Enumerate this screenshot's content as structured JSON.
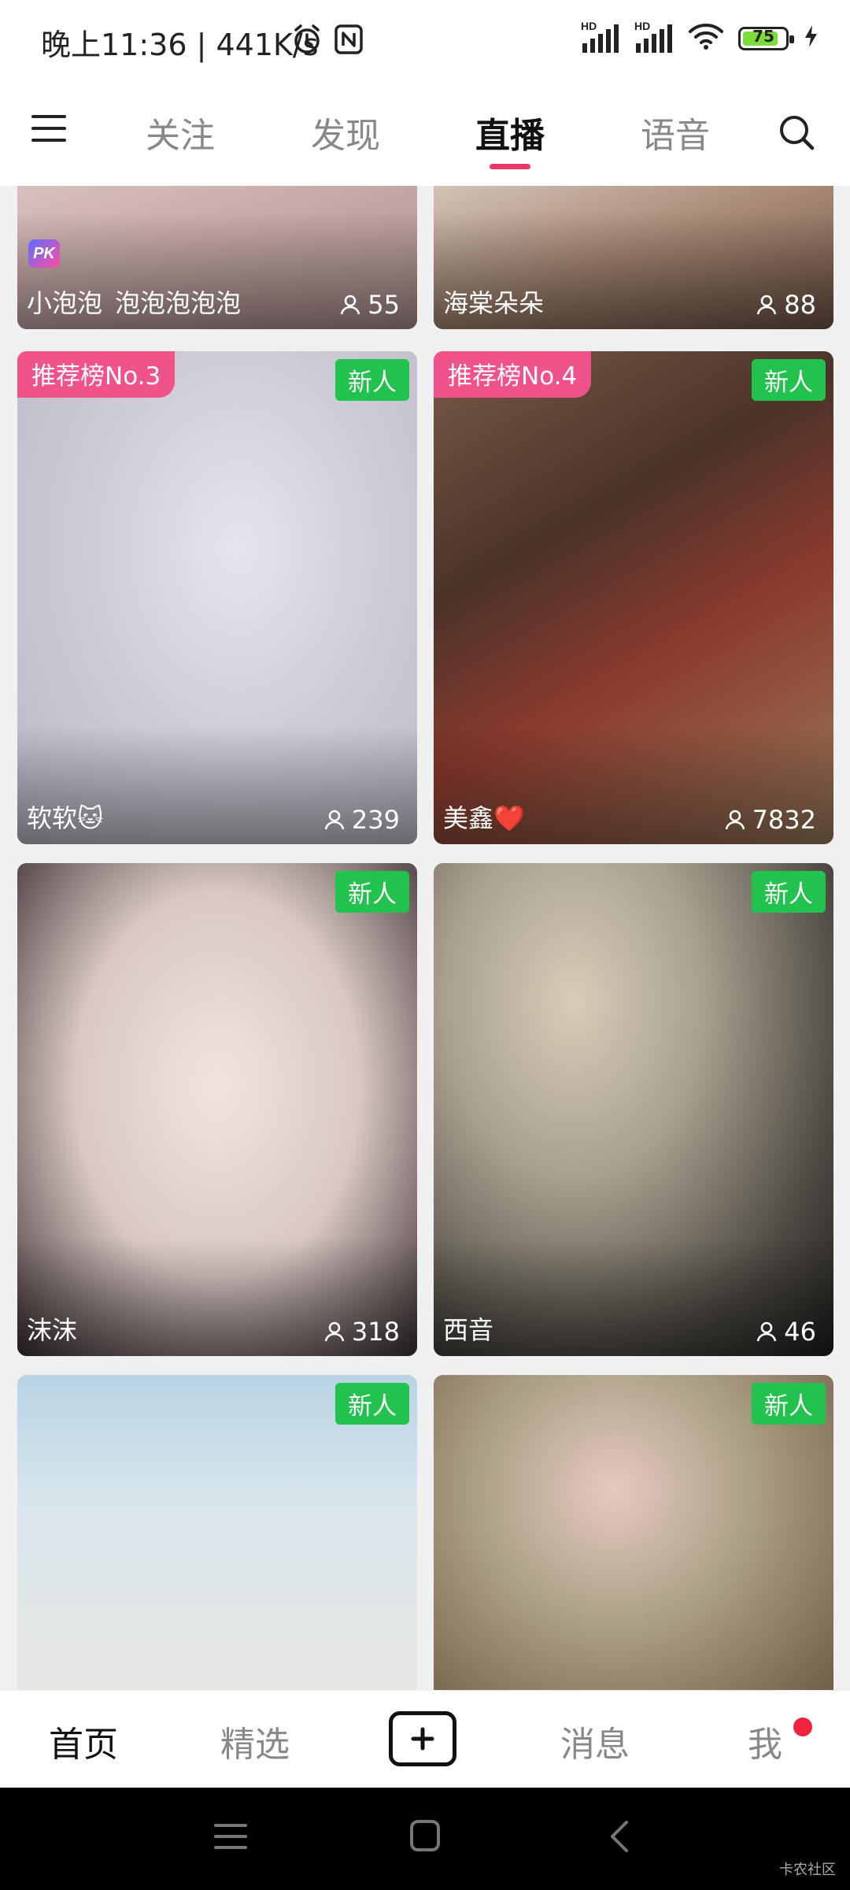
{
  "status_bar": {
    "time_text": "晚上11:36 | 441K/s",
    "network_1": "HD",
    "network_2": "HD",
    "battery": "75"
  },
  "top_nav": {
    "tabs": [
      {
        "label": "关注"
      },
      {
        "label": "发现"
      },
      {
        "label": "直播"
      },
      {
        "label": "语音"
      }
    ],
    "active_tab": "直播"
  },
  "cards": [
    {
      "name": "小泡泡 泡泡泡泡泡",
      "viewers": "55",
      "badge_pk": "PK"
    },
    {
      "name": "海棠朵朵",
      "viewers": "88"
    },
    {
      "name": "软软🐱",
      "viewers": "239",
      "rank": "推荐榜No.3",
      "new": "新人"
    },
    {
      "name": "美鑫❤️",
      "viewers": "7832",
      "rank": "推荐榜No.4",
      "new": "新人"
    },
    {
      "name": "沫沫",
      "viewers": "318",
      "new": "新人"
    },
    {
      "name": "西音",
      "viewers": "46",
      "new": "新人"
    },
    {
      "name": "",
      "viewers": "",
      "new": "新人"
    },
    {
      "name": "",
      "viewers": "",
      "new": "新人"
    }
  ],
  "bottom_nav": {
    "items": [
      {
        "label": "首页"
      },
      {
        "label": "精选"
      },
      {
        "label": "消息"
      },
      {
        "label": "我"
      }
    ],
    "active": "首页"
  },
  "watermark": "卡农社区",
  "colors": {
    "accent": "#e8396a",
    "new_badge": "#21c24d",
    "rank_badge": "#f0538a",
    "notify_dot": "#f0243e"
  }
}
